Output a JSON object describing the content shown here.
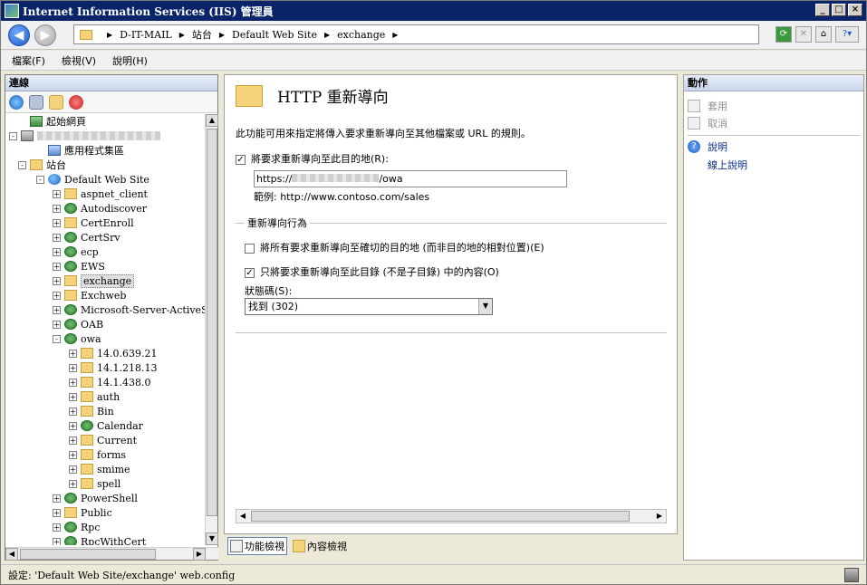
{
  "window": {
    "title": "Internet Information Services (IIS) 管理員",
    "controls": [
      "_",
      "□",
      "×"
    ]
  },
  "address": {
    "crumbs": [
      "D-IT-MAIL",
      "站台",
      "Default Web Site",
      "exchange"
    ]
  },
  "menu": [
    "檔案(F)",
    "檢視(V)",
    "說明(H)"
  ],
  "connections": {
    "header": "連線",
    "tree": [
      {
        "label": "起始網頁",
        "icon": "home-icon",
        "level": 1,
        "expander": ""
      },
      {
        "label": "",
        "icon": "server-icon",
        "level": 0,
        "expander": "-",
        "redacted": true
      },
      {
        "label": "應用程式集區",
        "icon": "app-pool-icon",
        "level": 2,
        "expander": ""
      },
      {
        "label": "站台",
        "icon": "sites-folder-icon",
        "level": 1,
        "expander": "-"
      },
      {
        "label": "Default Web Site",
        "icon": "globe-icon",
        "level": 2,
        "expander": "-"
      },
      {
        "label": "aspnet_client",
        "icon": "folder-icon",
        "level": 3,
        "expander": "+"
      },
      {
        "label": "Autodiscover",
        "icon": "app-icon",
        "level": 3,
        "expander": "+"
      },
      {
        "label": "CertEnroll",
        "icon": "folder-icon",
        "level": 3,
        "expander": "+"
      },
      {
        "label": "CertSrv",
        "icon": "app-icon",
        "level": 3,
        "expander": "+"
      },
      {
        "label": "ecp",
        "icon": "app-icon",
        "level": 3,
        "expander": "+"
      },
      {
        "label": "EWS",
        "icon": "app-icon",
        "level": 3,
        "expander": "+"
      },
      {
        "label": "exchange",
        "icon": "folder-icon",
        "level": 3,
        "expander": "+",
        "selected": true
      },
      {
        "label": "Exchweb",
        "icon": "folder-icon",
        "level": 3,
        "expander": "+"
      },
      {
        "label": "Microsoft-Server-ActiveS",
        "icon": "app-icon",
        "level": 3,
        "expander": "+"
      },
      {
        "label": "OAB",
        "icon": "app-icon",
        "level": 3,
        "expander": "+"
      },
      {
        "label": "owa",
        "icon": "app-icon",
        "level": 3,
        "expander": "-"
      },
      {
        "label": "14.0.639.21",
        "icon": "folder-icon",
        "level": 4,
        "expander": "+"
      },
      {
        "label": "14.1.218.13",
        "icon": "folder-icon",
        "level": 4,
        "expander": "+"
      },
      {
        "label": "14.1.438.0",
        "icon": "folder-icon",
        "level": 4,
        "expander": "+"
      },
      {
        "label": "auth",
        "icon": "folder-icon",
        "level": 4,
        "expander": "+"
      },
      {
        "label": "Bin",
        "icon": "folder-icon",
        "level": 4,
        "expander": "+"
      },
      {
        "label": "Calendar",
        "icon": "app-icon",
        "level": 4,
        "expander": "+"
      },
      {
        "label": "Current",
        "icon": "folder-icon",
        "level": 4,
        "expander": "+"
      },
      {
        "label": "forms",
        "icon": "folder-icon",
        "level": 4,
        "expander": "+"
      },
      {
        "label": "smime",
        "icon": "folder-icon",
        "level": 4,
        "expander": "+"
      },
      {
        "label": "spell",
        "icon": "folder-icon",
        "level": 4,
        "expander": "+"
      },
      {
        "label": "PowerShell",
        "icon": "app-icon",
        "level": 3,
        "expander": "+"
      },
      {
        "label": "Public",
        "icon": "folder-icon",
        "level": 3,
        "expander": "+"
      },
      {
        "label": "Rpc",
        "icon": "app-icon",
        "level": 3,
        "expander": "+"
      },
      {
        "label": "RpcWithCert",
        "icon": "app-icon",
        "level": 3,
        "expander": "+"
      }
    ]
  },
  "feature": {
    "title": "HTTP 重新導向",
    "description": "此功能可用來指定將傳入要求重新導向至其他檔案或 URL 的規則。",
    "redirect_checkbox_label": "將要求重新導向至此目的地(R):",
    "redirect_checked": "✓",
    "url_prefix": "https://",
    "url_suffix": "/owa",
    "example": "範例: http://www.contoso.com/sales",
    "group_label": "重新導向行為",
    "exact_label": "將所有要求重新導向至確切的目的地 (而非目的地的相對位置)(E)",
    "exact_checked": "",
    "only_dir_label": "只將要求重新導向至此目錄 (不是子目錄) 中的內容(O)",
    "only_dir_checked": "✓",
    "status_label": "狀態碼(S):",
    "status_value": "找到 (302)"
  },
  "view_tabs": {
    "features": "功能檢視",
    "content": "內容檢視"
  },
  "actions": {
    "header": "動作",
    "apply": "套用",
    "cancel": "取消",
    "help": "說明",
    "online_help": "線上說明"
  },
  "status": {
    "text": "設定: 'Default Web Site/exchange' web.config"
  }
}
